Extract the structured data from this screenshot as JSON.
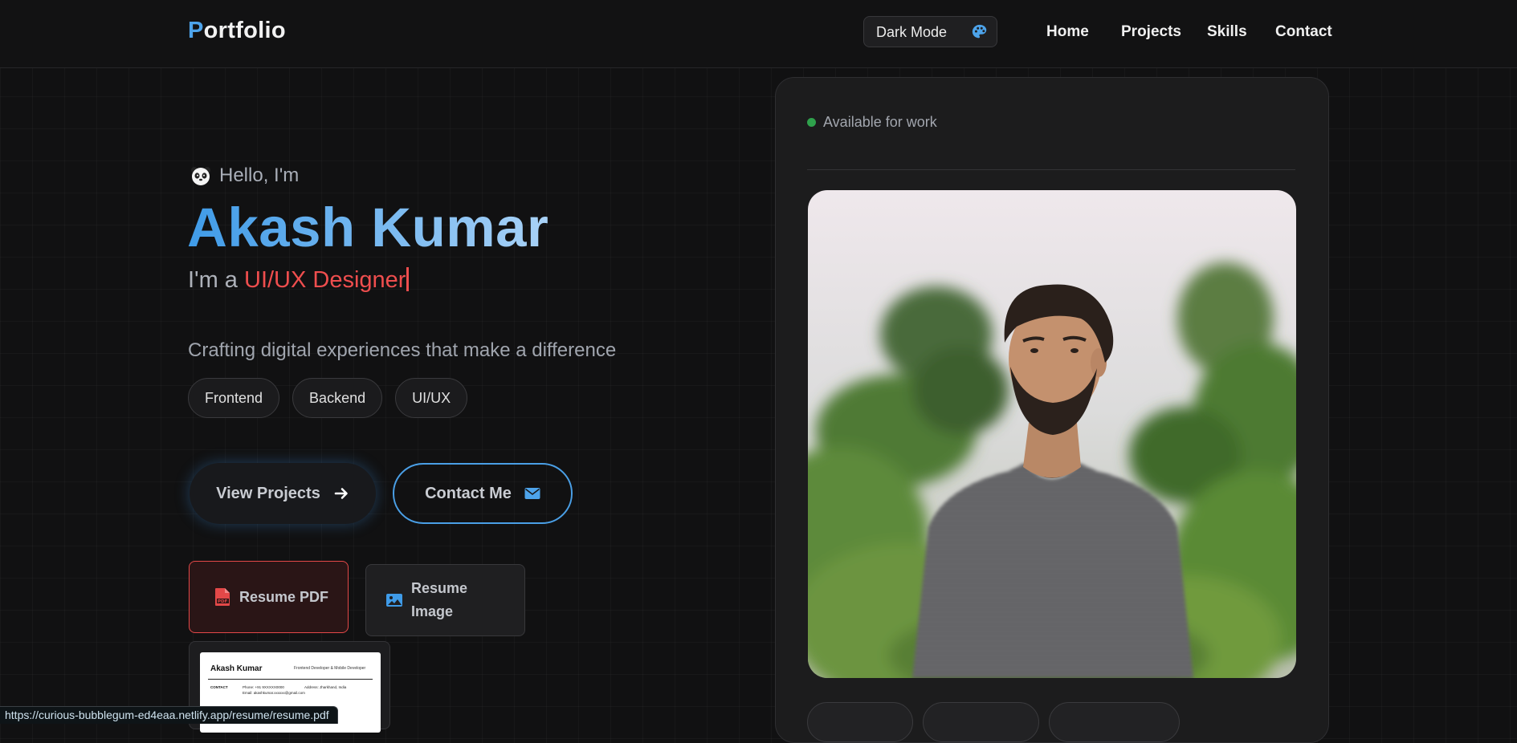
{
  "nav": {
    "logo_first": "P",
    "logo_rest": "ortfolio",
    "mode_label": "Dark Mode",
    "links": [
      "Home",
      "Projects",
      "Skills",
      "Contact"
    ]
  },
  "hero": {
    "greeting": "Hello, I'm",
    "name": "Akash Kumar",
    "role_prefix": "I'm a ",
    "role_highlight": "UI/UX Designer",
    "tagline": "Crafting digital experiences that make a difference",
    "pills": [
      "Frontend",
      "Backend",
      "UI/UX"
    ],
    "view_projects": "View Projects",
    "contact_me": "Contact Me",
    "resume_pdf": "Resume PDF",
    "resume_image": "Resume Image"
  },
  "resume_preview": {
    "name": "Akash Kumar",
    "role": "Frontend Developer & Mobile Developer",
    "contact_label": "CONTACT",
    "phone": "Phone: +91 9XXXXX0000",
    "email": "Email: akashkumar.xxxxxx@gmail.com",
    "address": "Address: Jharkhand, India"
  },
  "card": {
    "status": "Available for work",
    "status_color": "#2fa14c"
  },
  "status_url": "https://curious-bubblegum-ed4eaa.netlify.app/resume/resume.pdf",
  "colors": {
    "accent_blue": "#4da3ea",
    "accent_red": "#ef4e4e"
  },
  "icons": [
    "panda-icon",
    "palette-icon",
    "arrow-right-icon",
    "envelope-icon",
    "pdf-file-icon",
    "image-icon"
  ]
}
